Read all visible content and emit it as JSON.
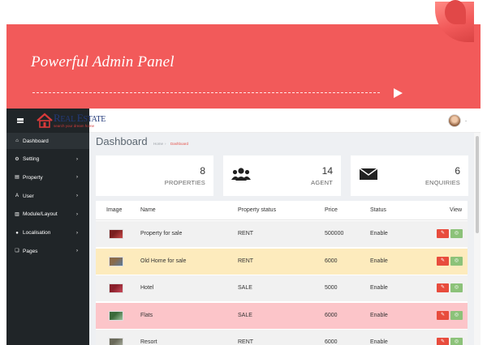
{
  "banner": {
    "title": "Powerful Admin Panel"
  },
  "logo": {
    "name_big": "R",
    "name_rest": "EAL ",
    "name_big2": "E",
    "name_rest2": "STATE",
    "tagline": "search your dream home"
  },
  "sidebar": {
    "items": [
      {
        "label": "Dashboard",
        "icon": "home-icon",
        "glyph": "⌂",
        "chevron": "",
        "active": true
      },
      {
        "label": "Setting",
        "icon": "gear-icon",
        "glyph": "⚙",
        "chevron": "›"
      },
      {
        "label": "Property",
        "icon": "file-icon",
        "glyph": "▤",
        "chevron": "›"
      },
      {
        "label": "User",
        "icon": "user-font-icon",
        "glyph": "A",
        "chevron": "›"
      },
      {
        "label": "Module/Layout",
        "icon": "chart-icon",
        "glyph": "▥",
        "chevron": "›"
      },
      {
        "label": "Localisation",
        "icon": "map-pin-icon",
        "glyph": "●",
        "chevron": "›"
      },
      {
        "label": "Pages",
        "icon": "pages-icon",
        "glyph": "❏",
        "chevron": "›"
      }
    ]
  },
  "page": {
    "title": "Dashboard",
    "breadcrumb_home": "Home",
    "breadcrumb_sep": "›",
    "breadcrumb_current": "Dashboard"
  },
  "stats": [
    {
      "value": "8",
      "label": "PROPERTIES",
      "icon": "none"
    },
    {
      "value": "14",
      "label": "AGENT",
      "icon": "users-icon"
    },
    {
      "value": "6",
      "label": "ENQUIRIES",
      "icon": "envelope-icon"
    }
  ],
  "table": {
    "headers": [
      "Image",
      "Name",
      "Property status",
      "Price",
      "Status",
      "View"
    ],
    "rows": [
      {
        "name": "Property for sale",
        "status": "RENT",
        "price": "500000",
        "state": "Enable",
        "bg": "#f1f1f1"
      },
      {
        "name": "Old Home for sale",
        "status": "RENT",
        "price": "6000",
        "state": "Enable",
        "bg": "#fdebbd"
      },
      {
        "name": "Hotel",
        "status": "SALE",
        "price": "5000",
        "state": "Enable",
        "bg": "#f1f1f1"
      },
      {
        "name": "Flats",
        "status": "SALE",
        "price": "6000",
        "state": "Enable",
        "bg": "#fcc5c9"
      },
      {
        "name": "Resort",
        "status": "RENT",
        "price": "6000",
        "state": "Enable",
        "bg": "#f1f1f1"
      }
    ],
    "edit_glyph": "✎",
    "view_glyph": "◎"
  },
  "colors": {
    "banner": "#f25a5a",
    "sidebar": "#202528",
    "accent_red": "#e84c3d",
    "accent_green": "#8cc279"
  }
}
